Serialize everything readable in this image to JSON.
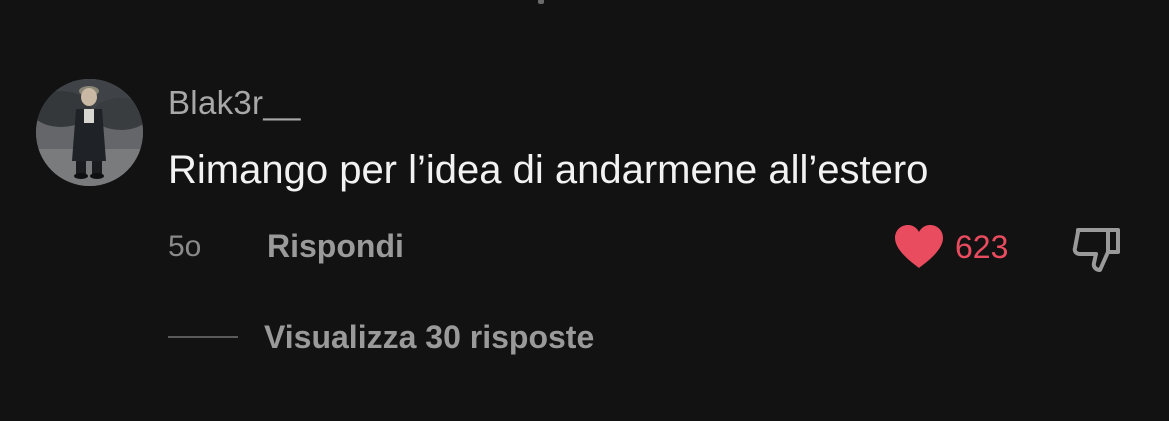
{
  "comment": {
    "username": "Blak3r__",
    "text": "Rimango per l’idea di andarmene all’estero",
    "age": "5o",
    "reply_label": "Rispondi",
    "like_count": "623",
    "view_replies_label": "Visualizza 30 risposte"
  },
  "icons": {
    "avatar": "avatar-photo",
    "like": "heart-icon",
    "dislike": "thumbs-down-icon"
  },
  "colors": {
    "background": "#121212",
    "like_accent": "#e94b5f",
    "text_primary": "#f2f2f2",
    "text_secondary": "#a8a8a8"
  }
}
